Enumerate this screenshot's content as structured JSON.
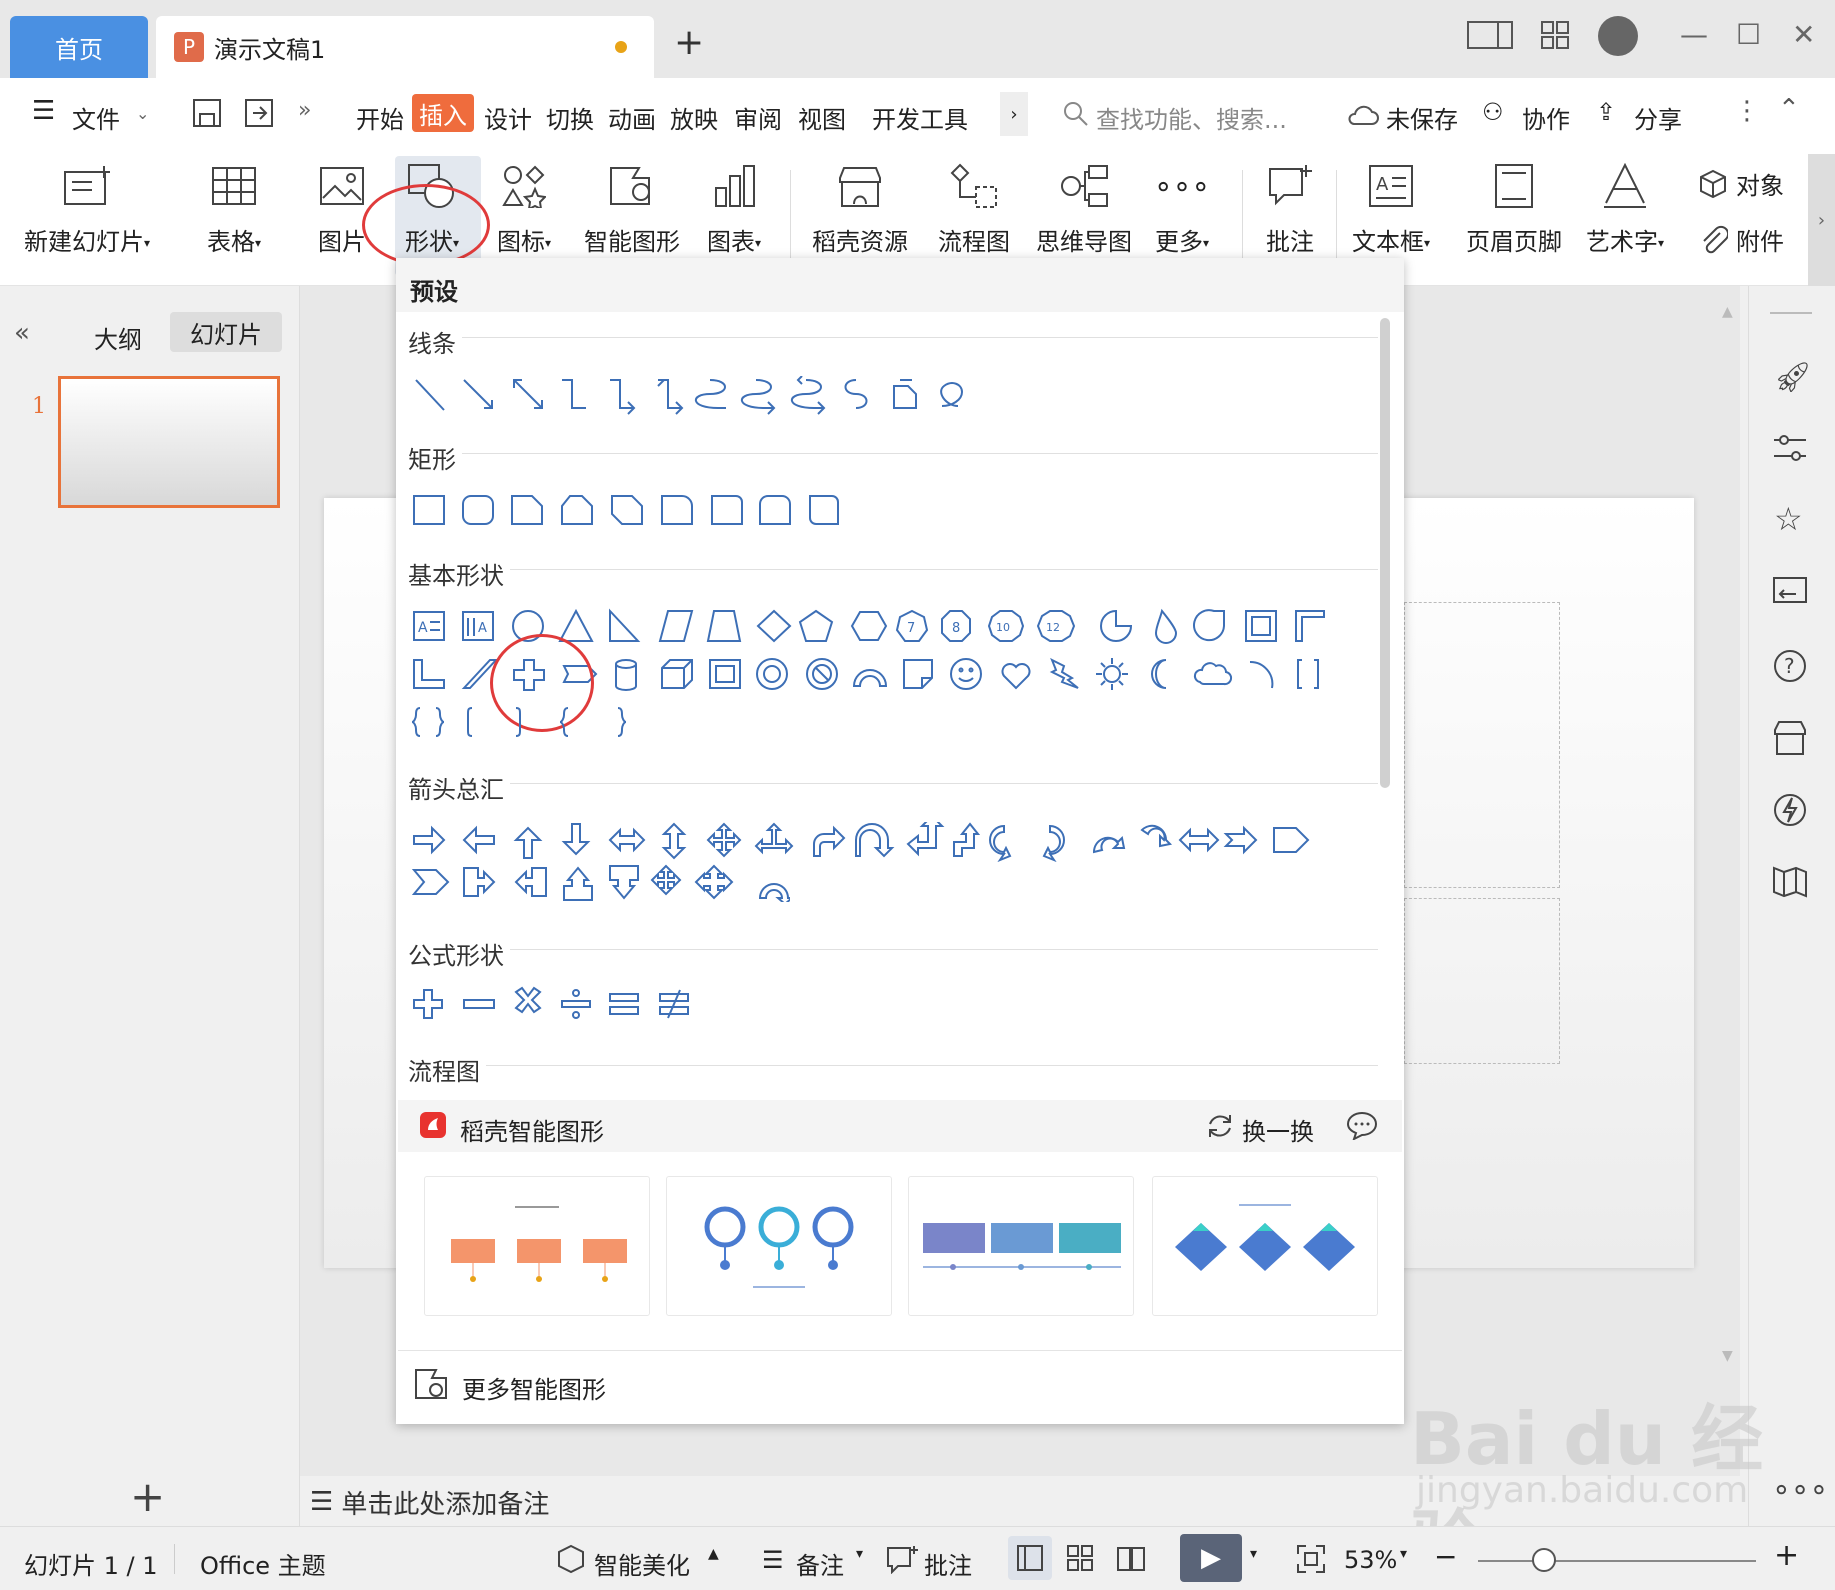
{
  "tabs": {
    "home": "首页",
    "doc": "演示文稿1",
    "doc_icon": "P",
    "add": "+"
  },
  "menubar": {
    "file": "文件",
    "items": [
      "开始",
      "插入",
      "设计",
      "切换",
      "动画",
      "放映",
      "审阅",
      "视图",
      "开发工具"
    ],
    "search_placeholder": "查找功能、搜索...",
    "unsaved": "未保存",
    "collab": "协作",
    "share": "分享"
  },
  "ribbon": {
    "new_slide": "新建幻灯片",
    "table": "表格",
    "picture": "图片",
    "shape": "形状",
    "icon": "图标",
    "smart_art": "智能图形",
    "chart": "图表",
    "resources": "稻壳资源",
    "flowchart": "流程图",
    "mindmap": "思维导图",
    "more": "更多",
    "comment": "批注",
    "textbox": "文本框",
    "header_footer": "页眉页脚",
    "wordart": "艺术字",
    "object": "对象",
    "attachment": "附件"
  },
  "leftpanel": {
    "outline": "大纲",
    "slides": "幻灯片",
    "slide_number": "1",
    "add": "+"
  },
  "dropdown": {
    "title": "预设",
    "sections": {
      "lines": "线条",
      "rect": "矩形",
      "basic": "基本形状",
      "arrows": "箭头总汇",
      "formula": "公式形状",
      "flow": "流程图"
    },
    "ai_title": "稻壳智能图形",
    "refresh": "换一换",
    "more_smart": "更多智能图形"
  },
  "notes": {
    "placeholder": "单击此处添加备注"
  },
  "status": {
    "slide_count": "幻灯片 1 / 1",
    "theme": "Office 主题",
    "beautify": "智能美化",
    "notes": "备注",
    "comment": "批注",
    "zoom": "53%"
  },
  "watermark": {
    "brand": "Bai du 经验",
    "url": "jingyan.baidu.com"
  },
  "colors": {
    "accent": "#ef6c3d",
    "home_tab": "#4a90e2",
    "shape_stroke": "#3d6fb6",
    "highlight_circle": "#e03b3b"
  }
}
